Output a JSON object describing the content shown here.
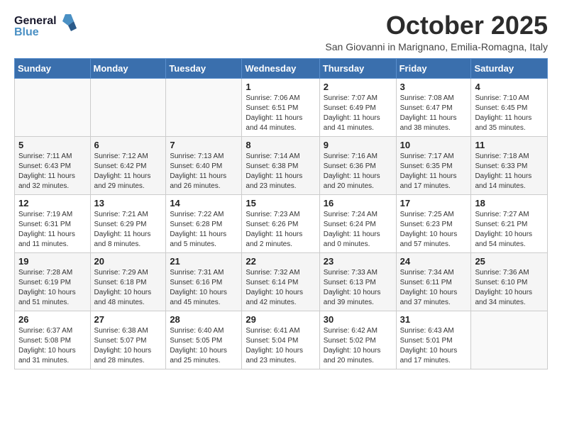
{
  "logo": {
    "general": "General",
    "blue": "Blue"
  },
  "title": "October 2025",
  "subtitle": "San Giovanni in Marignano, Emilia-Romagna, Italy",
  "days_header": [
    "Sunday",
    "Monday",
    "Tuesday",
    "Wednesday",
    "Thursday",
    "Friday",
    "Saturday"
  ],
  "weeks": [
    [
      {
        "day": "",
        "sunrise": "",
        "sunset": "",
        "daylight": ""
      },
      {
        "day": "",
        "sunrise": "",
        "sunset": "",
        "daylight": ""
      },
      {
        "day": "",
        "sunrise": "",
        "sunset": "",
        "daylight": ""
      },
      {
        "day": "1",
        "sunrise": "Sunrise: 7:06 AM",
        "sunset": "Sunset: 6:51 PM",
        "daylight": "Daylight: 11 hours and 44 minutes."
      },
      {
        "day": "2",
        "sunrise": "Sunrise: 7:07 AM",
        "sunset": "Sunset: 6:49 PM",
        "daylight": "Daylight: 11 hours and 41 minutes."
      },
      {
        "day": "3",
        "sunrise": "Sunrise: 7:08 AM",
        "sunset": "Sunset: 6:47 PM",
        "daylight": "Daylight: 11 hours and 38 minutes."
      },
      {
        "day": "4",
        "sunrise": "Sunrise: 7:10 AM",
        "sunset": "Sunset: 6:45 PM",
        "daylight": "Daylight: 11 hours and 35 minutes."
      }
    ],
    [
      {
        "day": "5",
        "sunrise": "Sunrise: 7:11 AM",
        "sunset": "Sunset: 6:43 PM",
        "daylight": "Daylight: 11 hours and 32 minutes."
      },
      {
        "day": "6",
        "sunrise": "Sunrise: 7:12 AM",
        "sunset": "Sunset: 6:42 PM",
        "daylight": "Daylight: 11 hours and 29 minutes."
      },
      {
        "day": "7",
        "sunrise": "Sunrise: 7:13 AM",
        "sunset": "Sunset: 6:40 PM",
        "daylight": "Daylight: 11 hours and 26 minutes."
      },
      {
        "day": "8",
        "sunrise": "Sunrise: 7:14 AM",
        "sunset": "Sunset: 6:38 PM",
        "daylight": "Daylight: 11 hours and 23 minutes."
      },
      {
        "day": "9",
        "sunrise": "Sunrise: 7:16 AM",
        "sunset": "Sunset: 6:36 PM",
        "daylight": "Daylight: 11 hours and 20 minutes."
      },
      {
        "day": "10",
        "sunrise": "Sunrise: 7:17 AM",
        "sunset": "Sunset: 6:35 PM",
        "daylight": "Daylight: 11 hours and 17 minutes."
      },
      {
        "day": "11",
        "sunrise": "Sunrise: 7:18 AM",
        "sunset": "Sunset: 6:33 PM",
        "daylight": "Daylight: 11 hours and 14 minutes."
      }
    ],
    [
      {
        "day": "12",
        "sunrise": "Sunrise: 7:19 AM",
        "sunset": "Sunset: 6:31 PM",
        "daylight": "Daylight: 11 hours and 11 minutes."
      },
      {
        "day": "13",
        "sunrise": "Sunrise: 7:21 AM",
        "sunset": "Sunset: 6:29 PM",
        "daylight": "Daylight: 11 hours and 8 minutes."
      },
      {
        "day": "14",
        "sunrise": "Sunrise: 7:22 AM",
        "sunset": "Sunset: 6:28 PM",
        "daylight": "Daylight: 11 hours and 5 minutes."
      },
      {
        "day": "15",
        "sunrise": "Sunrise: 7:23 AM",
        "sunset": "Sunset: 6:26 PM",
        "daylight": "Daylight: 11 hours and 2 minutes."
      },
      {
        "day": "16",
        "sunrise": "Sunrise: 7:24 AM",
        "sunset": "Sunset: 6:24 PM",
        "daylight": "Daylight: 11 hours and 0 minutes."
      },
      {
        "day": "17",
        "sunrise": "Sunrise: 7:25 AM",
        "sunset": "Sunset: 6:23 PM",
        "daylight": "Daylight: 10 hours and 57 minutes."
      },
      {
        "day": "18",
        "sunrise": "Sunrise: 7:27 AM",
        "sunset": "Sunset: 6:21 PM",
        "daylight": "Daylight: 10 hours and 54 minutes."
      }
    ],
    [
      {
        "day": "19",
        "sunrise": "Sunrise: 7:28 AM",
        "sunset": "Sunset: 6:19 PM",
        "daylight": "Daylight: 10 hours and 51 minutes."
      },
      {
        "day": "20",
        "sunrise": "Sunrise: 7:29 AM",
        "sunset": "Sunset: 6:18 PM",
        "daylight": "Daylight: 10 hours and 48 minutes."
      },
      {
        "day": "21",
        "sunrise": "Sunrise: 7:31 AM",
        "sunset": "Sunset: 6:16 PM",
        "daylight": "Daylight: 10 hours and 45 minutes."
      },
      {
        "day": "22",
        "sunrise": "Sunrise: 7:32 AM",
        "sunset": "Sunset: 6:14 PM",
        "daylight": "Daylight: 10 hours and 42 minutes."
      },
      {
        "day": "23",
        "sunrise": "Sunrise: 7:33 AM",
        "sunset": "Sunset: 6:13 PM",
        "daylight": "Daylight: 10 hours and 39 minutes."
      },
      {
        "day": "24",
        "sunrise": "Sunrise: 7:34 AM",
        "sunset": "Sunset: 6:11 PM",
        "daylight": "Daylight: 10 hours and 37 minutes."
      },
      {
        "day": "25",
        "sunrise": "Sunrise: 7:36 AM",
        "sunset": "Sunset: 6:10 PM",
        "daylight": "Daylight: 10 hours and 34 minutes."
      }
    ],
    [
      {
        "day": "26",
        "sunrise": "Sunrise: 6:37 AM",
        "sunset": "Sunset: 5:08 PM",
        "daylight": "Daylight: 10 hours and 31 minutes."
      },
      {
        "day": "27",
        "sunrise": "Sunrise: 6:38 AM",
        "sunset": "Sunset: 5:07 PM",
        "daylight": "Daylight: 10 hours and 28 minutes."
      },
      {
        "day": "28",
        "sunrise": "Sunrise: 6:40 AM",
        "sunset": "Sunset: 5:05 PM",
        "daylight": "Daylight: 10 hours and 25 minutes."
      },
      {
        "day": "29",
        "sunrise": "Sunrise: 6:41 AM",
        "sunset": "Sunset: 5:04 PM",
        "daylight": "Daylight: 10 hours and 23 minutes."
      },
      {
        "day": "30",
        "sunrise": "Sunrise: 6:42 AM",
        "sunset": "Sunset: 5:02 PM",
        "daylight": "Daylight: 10 hours and 20 minutes."
      },
      {
        "day": "31",
        "sunrise": "Sunrise: 6:43 AM",
        "sunset": "Sunset: 5:01 PM",
        "daylight": "Daylight: 10 hours and 17 minutes."
      },
      {
        "day": "",
        "sunrise": "",
        "sunset": "",
        "daylight": ""
      }
    ]
  ]
}
